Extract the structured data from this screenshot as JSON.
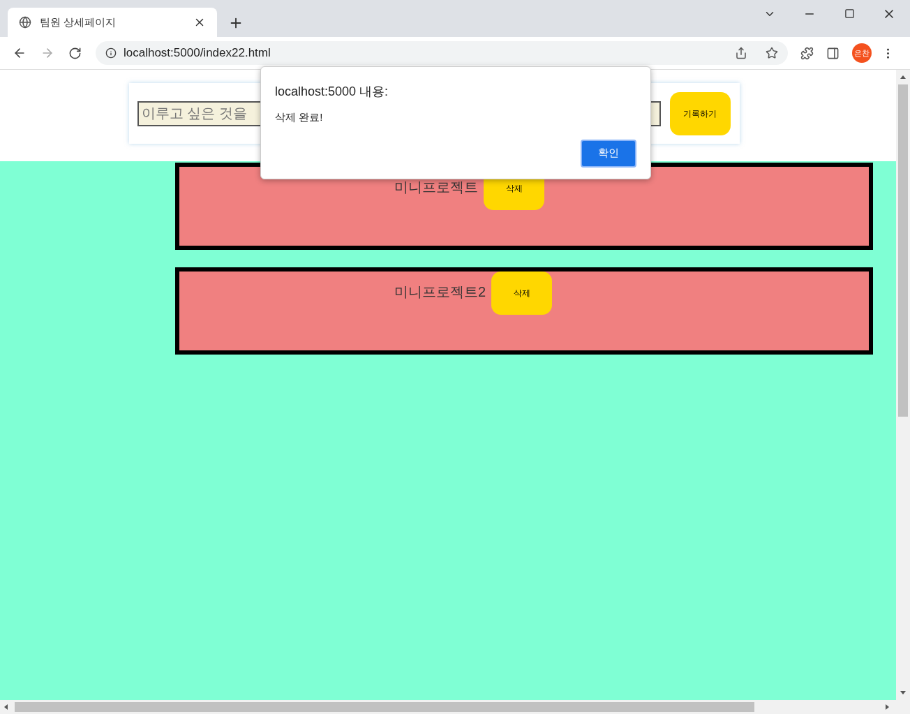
{
  "browser": {
    "tabs": [
      {
        "title": "팀원 상세페이지",
        "selected": true
      }
    ],
    "address": "localhost:5000/index22.html",
    "profile": "은찬"
  },
  "form": {
    "placeholder": "이루고 싶은 것을",
    "button": "기록하기"
  },
  "cards": [
    {
      "title": "미니프로젝트",
      "button": "삭제"
    },
    {
      "title": "미니프로젝트2",
      "button": "삭제"
    }
  ],
  "dialog": {
    "title": "localhost:5000 내용:",
    "message": "삭제 완료!",
    "button": "확인"
  }
}
